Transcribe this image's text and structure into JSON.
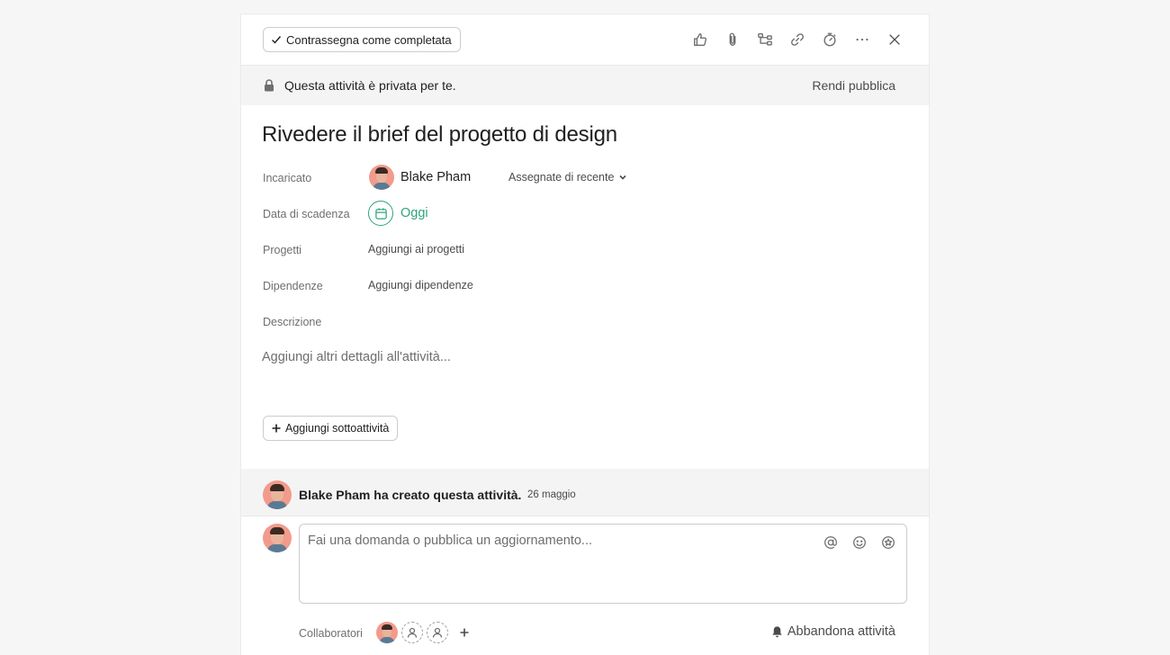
{
  "toolbar": {
    "complete_label": "Contrassegna come completata",
    "icons": [
      "like-icon",
      "attachment-icon",
      "subtask-icon",
      "link-icon",
      "timer-icon",
      "more-icon",
      "close-icon"
    ]
  },
  "privacy": {
    "message": "Questa attività è privata per te.",
    "action": "Rendi pubblica"
  },
  "task": {
    "title": "Rivedere il brief del progetto di design"
  },
  "fields": {
    "assignee_label": "Incaricato",
    "assignee_name": "Blake Pham",
    "recent_label": "Assegnate di recente",
    "due_label": "Data di scadenza",
    "due_value": "Oggi",
    "projects_label": "Progetti",
    "projects_action": "Aggiungi ai progetti",
    "dependencies_label": "Dipendenze",
    "dependencies_action": "Aggiungi dipendenze",
    "description_label": "Descrizione",
    "description_placeholder": "Aggiungi altri dettagli all'attività..."
  },
  "subtask": {
    "add_label": "Aggiungi sottoattività"
  },
  "activity": {
    "text": "Blake Pham ha creato questa attività.",
    "date": "26 maggio"
  },
  "comment": {
    "placeholder": "Fai una domanda o pubblica un aggiornamento..."
  },
  "collaborators": {
    "label": "Collaboratori",
    "leave_label": "Abbandona attività"
  },
  "colors": {
    "accent_green": "#2fa37c",
    "avatar_bg": "#f29b8c"
  }
}
